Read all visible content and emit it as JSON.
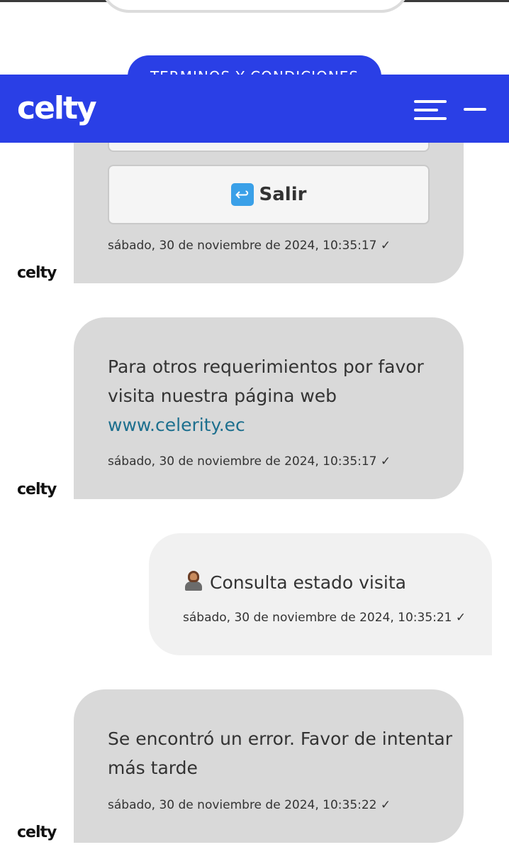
{
  "app": {
    "brand": "celty",
    "terms_button": "TERMINOS Y CONDICIONES"
  },
  "header": {
    "logo": "celty",
    "menu_icon": "menu-icon",
    "minimize_icon": "minimize-icon"
  },
  "messages": [
    {
      "sender": "bot",
      "button_label": "Salir",
      "button_icon": "return-arrow-icon",
      "timestamp": "sábado, 30 de noviembre de 2024, 10:35:17 ✓"
    },
    {
      "sender": "bot",
      "text_line1": "Para otros requerimientos por favor",
      "text_line2": "visita nuestra página web",
      "link": "www.celerity.ec",
      "timestamp": "sábado, 30 de noviembre de 2024, 10:35:17 ✓"
    },
    {
      "sender": "user",
      "icon": "technologist-woman-icon",
      "text": "Consulta estado visita",
      "timestamp": "sábado, 30 de noviembre de 2024, 10:35:21 ✓"
    },
    {
      "sender": "bot",
      "text_line1": "Se encontró un error. Favor de intentar",
      "text_line2": "más tarde",
      "timestamp": "sábado, 30 de noviembre de 2024, 10:35:22 ✓"
    }
  ],
  "avatar": {
    "label": "celty"
  },
  "colors": {
    "brand_blue": "#2a3fe6",
    "bot_bubble": "#d9d9d9",
    "user_bubble": "#f1f1f1",
    "link": "#1d6f8e"
  }
}
